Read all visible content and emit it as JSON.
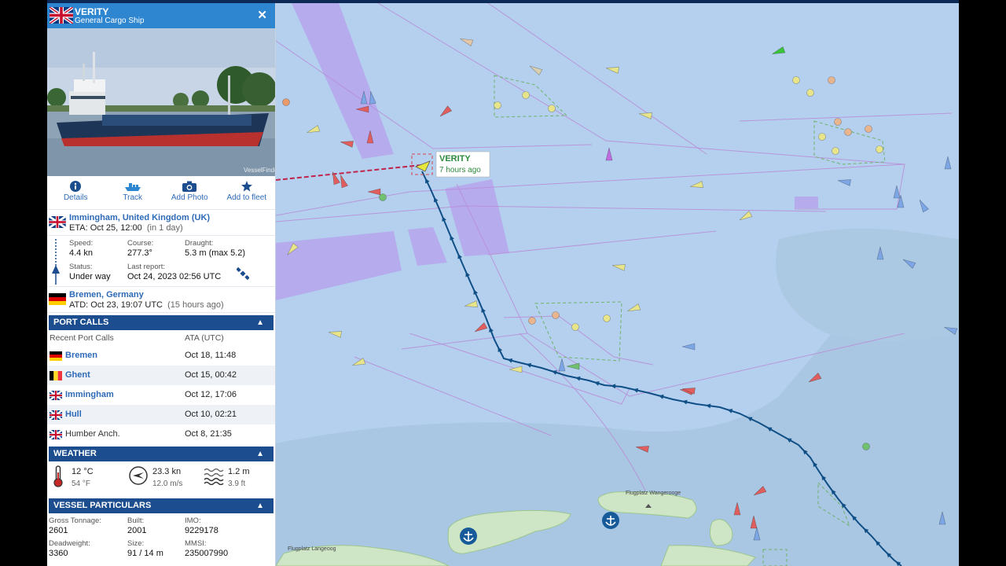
{
  "vessel": {
    "name": "VERITY",
    "type": "General Cargo Ship",
    "flag": "uk-flag",
    "photo_watermark": "VesselFinder"
  },
  "actions": [
    {
      "label": "Details",
      "icon": "info-icon"
    },
    {
      "label": "Track",
      "icon": "ship-track-icon"
    },
    {
      "label": "Add Photo",
      "icon": "camera-icon"
    },
    {
      "label": "Add to fleet",
      "icon": "star-icon"
    }
  ],
  "destination": {
    "port": "Immingham, United Kingdom (UK)",
    "eta": "ETA: Oct 25, 12:00",
    "eta_rel": "(in 1 day)"
  },
  "stats": {
    "speed_label": "Speed:",
    "speed": "4.4 kn",
    "course_label": "Course:",
    "course": "277.3°",
    "draught_label": "Draught:",
    "draught": "5.3 m (max 5.2)",
    "status_label": "Status:",
    "status": "Under way",
    "report_label": "Last report:",
    "report": "Oct 24, 2023 02:56 UTC"
  },
  "origin": {
    "port": "Bremen, Germany",
    "atd": "ATD: Oct 23, 19:07 UTC",
    "atd_rel": "(15 hours ago)"
  },
  "port_calls": {
    "title": "PORT CALLS",
    "col1": "Recent Port Calls",
    "col2": "ATA (UTC)",
    "rows": [
      {
        "port": "Bremen",
        "time": "Oct 18, 11:48",
        "flag": "de-flag",
        "link": true
      },
      {
        "port": "Ghent",
        "time": "Oct 15, 00:42",
        "flag": "be-flag",
        "link": true
      },
      {
        "port": "Immingham",
        "time": "Oct 12, 17:06",
        "flag": "uk-flag",
        "link": true
      },
      {
        "port": "Hull",
        "time": "Oct 10, 02:21",
        "flag": "uk-flag",
        "link": true
      },
      {
        "port": "Humber Anch.",
        "time": "Oct 8, 21:35",
        "flag": "uk-flag",
        "link": false
      }
    ]
  },
  "weather": {
    "title": "WEATHER",
    "temp_c": "12 °C",
    "temp_f": "54 °F",
    "wind_kn": "23.3 kn",
    "wind_ms": "12.0 m/s",
    "wave_m": "1.2 m",
    "wave_ft": "3.9 ft"
  },
  "particulars": {
    "title": "VESSEL PARTICULARS",
    "gt_label": "Gross Tonnage:",
    "gt": "2601",
    "built_label": "Built:",
    "built": "2001",
    "imo_label": "IMO:",
    "imo": "9229178",
    "dwt_label": "Deadweight:",
    "dwt": "3360",
    "size_label": "Size:",
    "size": "91 / 14 m",
    "mmsi_label": "MMSI:",
    "mmsi": "235007990"
  },
  "map": {
    "label_name": "VERITY",
    "label_time": "7 hours ago",
    "airfield_1": "Flugplatz Wangerooge",
    "airfield_2": "Flugplatz Langeoog",
    "colors": {
      "sea": "#b4d0ee",
      "shallow": "#a9c6e2",
      "land": "#cfe6c6",
      "track": "#0f4f86",
      "lanes": "#b5a4ec"
    }
  }
}
